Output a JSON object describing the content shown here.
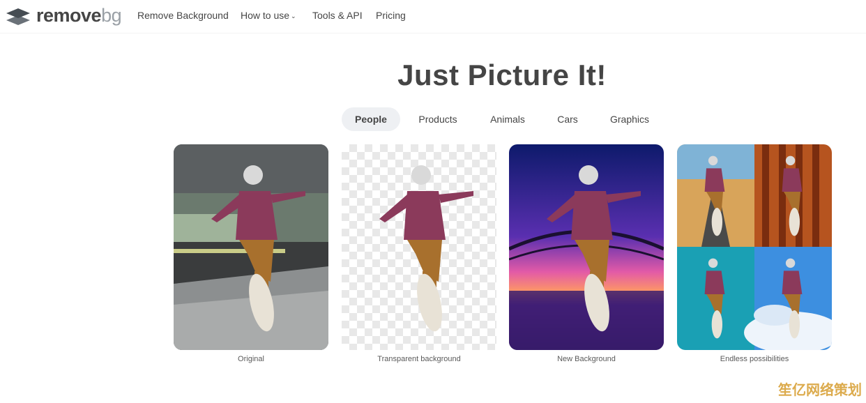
{
  "brand": {
    "remove": "remove",
    "bg": "bg"
  },
  "nav": {
    "remove_background": "Remove Background",
    "how_to_use": "How to use",
    "tools_api": "Tools & API",
    "pricing": "Pricing"
  },
  "hero": {
    "title": "Just Picture It!"
  },
  "tabs": [
    {
      "label": "People",
      "active": true
    },
    {
      "label": "Products",
      "active": false
    },
    {
      "label": "Animals",
      "active": false
    },
    {
      "label": "Cars",
      "active": false
    },
    {
      "label": "Graphics",
      "active": false
    }
  ],
  "examples": [
    {
      "caption": "Original"
    },
    {
      "caption": "Transparent background"
    },
    {
      "caption": "New Background"
    },
    {
      "caption": "Endless possibilities"
    }
  ],
  "watermark": "笙亿网络策划",
  "colors": {
    "text": "#454545",
    "tab_active_bg": "#eef0f3",
    "brand_gray": "#9aa0a6"
  }
}
